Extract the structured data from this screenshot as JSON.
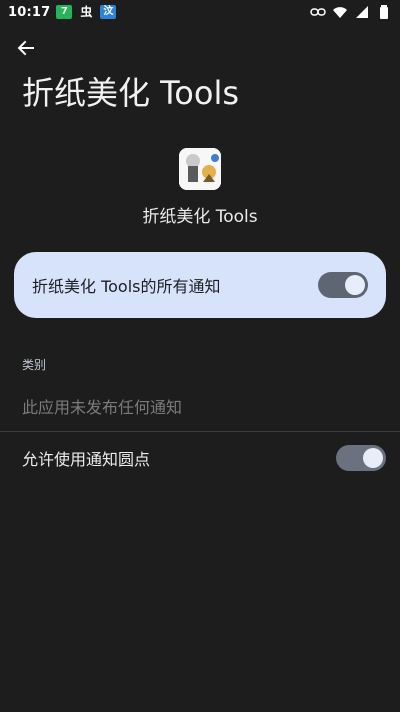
{
  "status_bar": {
    "time": "10:17",
    "badges": [
      "7",
      "虫",
      "汶"
    ]
  },
  "page": {
    "title": "折纸美化 Tools"
  },
  "app": {
    "name": "折纸美化 Tools"
  },
  "all_notifications": {
    "label": "折纸美化 Tools的所有通知",
    "enabled": true
  },
  "category": {
    "header": "类别",
    "empty_message": "此应用未发布任何通知"
  },
  "notification_dot": {
    "label": "允许使用通知圆点",
    "enabled": true
  },
  "colors": {
    "background": "#1d1d1d",
    "card": "#d6e3fb",
    "switch_track": "#5e6673"
  }
}
